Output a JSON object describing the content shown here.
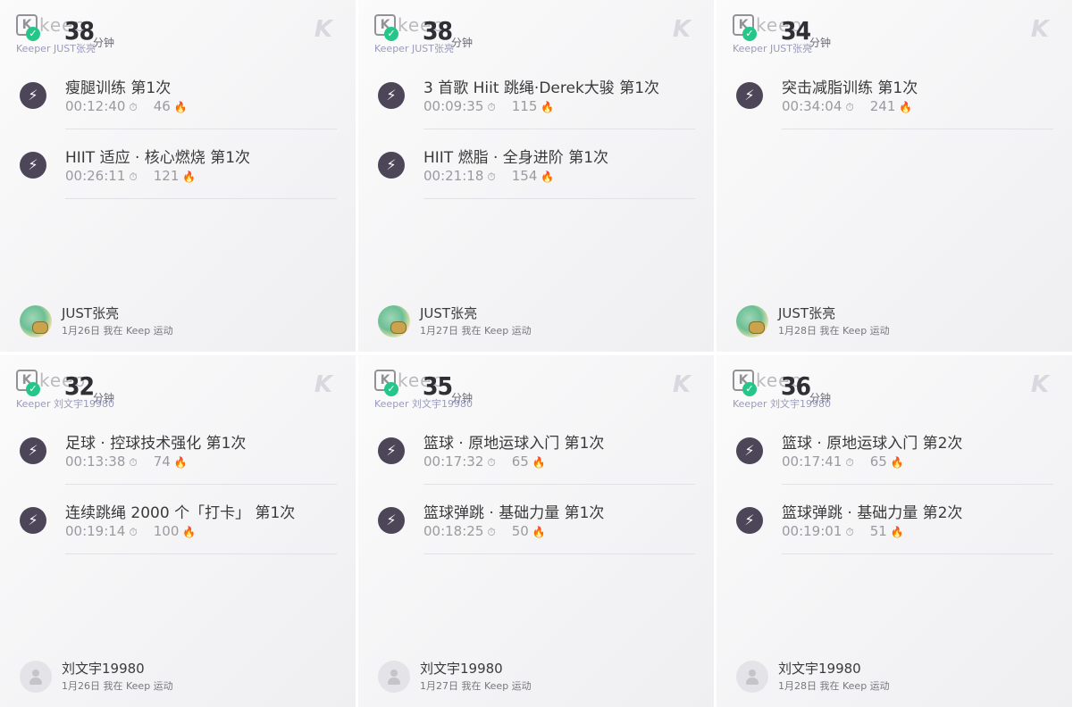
{
  "brand": {
    "logo_letter": "K",
    "logo_text": "keep",
    "sub_label": "Keeper JUST张亮",
    "watermark": "K",
    "unit": "分钟",
    "accent": "#24c789",
    "bolt_bg": "#4d4658"
  },
  "cards": [
    {
      "day": "38",
      "sub_label": "Keeper JUST张亮",
      "workouts": [
        {
          "title": "瘦腿训练 第1次",
          "time": "00:12:40",
          "kcal": "46"
        },
        {
          "title": "HIIT 适应 · 核心燃烧 第1次",
          "time": "00:26:11",
          "kcal": "121"
        }
      ],
      "user": {
        "name": "JUST张亮",
        "date": "1月26日 我在 Keep 运动",
        "avatar": "green"
      }
    },
    {
      "day": "38",
      "sub_label": "Keeper JUST张亮",
      "workouts": [
        {
          "title": "3 首歌 Hiit 跳绳·Derek大骏 第1次",
          "time": "00:09:35",
          "kcal": "115"
        },
        {
          "title": "HIIT 燃脂 · 全身进阶 第1次",
          "time": "00:21:18",
          "kcal": "154"
        }
      ],
      "user": {
        "name": "JUST张亮",
        "date": "1月27日 我在 Keep 运动",
        "avatar": "green"
      }
    },
    {
      "day": "34",
      "sub_label": "Keeper JUST张亮",
      "workouts": [
        {
          "title": "突击减脂训练 第1次",
          "time": "00:34:04",
          "kcal": "241"
        }
      ],
      "user": {
        "name": "JUST张亮",
        "date": "1月28日 我在 Keep 运动",
        "avatar": "green"
      }
    },
    {
      "day": "32",
      "sub_label": "Keeper 刘文宇19980",
      "workouts": [
        {
          "title": "足球 · 控球技术强化 第1次",
          "time": "00:13:38",
          "kcal": "74"
        },
        {
          "title": "连续跳绳 2000 个「打卡」 第1次",
          "time": "00:19:14",
          "kcal": "100"
        }
      ],
      "user": {
        "name": "刘文宇19980",
        "date": "1月26日 我在 Keep 运动",
        "avatar": "gray"
      }
    },
    {
      "day": "35",
      "sub_label": "Keeper 刘文宇19980",
      "workouts": [
        {
          "title": "篮球 · 原地运球入门 第1次",
          "time": "00:17:32",
          "kcal": "65"
        },
        {
          "title": "篮球弹跳 · 基础力量 第1次",
          "time": "00:18:25",
          "kcal": "50"
        }
      ],
      "user": {
        "name": "刘文宇19980",
        "date": "1月27日 我在 Keep 运动",
        "avatar": "gray"
      }
    },
    {
      "day": "36",
      "sub_label": "Keeper 刘文宇19980",
      "workouts": [
        {
          "title": "篮球 · 原地运球入门 第2次",
          "time": "00:17:41",
          "kcal": "65"
        },
        {
          "title": "篮球弹跳 · 基础力量 第2次",
          "time": "00:19:01",
          "kcal": "51"
        }
      ],
      "user": {
        "name": "刘文宇19980",
        "date": "1月28日 我在 Keep 运动",
        "avatar": "gray"
      }
    }
  ]
}
